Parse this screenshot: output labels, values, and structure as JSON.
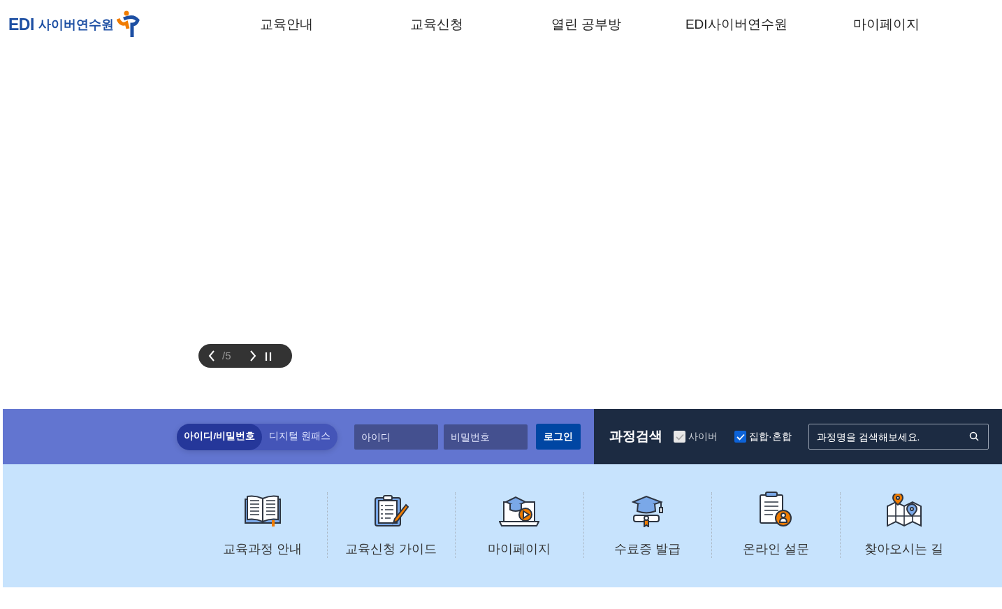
{
  "logo": {
    "brand": "EDI",
    "name": "사이버연수원"
  },
  "nav": [
    "교육안내",
    "교육신청",
    "열린 공부방",
    "EDI사이버연수원",
    "마이페이지"
  ],
  "slider": {
    "counter": "/5",
    "paused": false
  },
  "login": {
    "tabs": [
      {
        "label": "아이디/비밀번호",
        "selected": true
      },
      {
        "label": "디지털 원패스",
        "selected": false
      }
    ],
    "id_field": {
      "placeholder": "아이디"
    },
    "pw_field": {
      "placeholder": "비밀번호"
    },
    "button": "로그인"
  },
  "course_search": {
    "title": "과정검색",
    "filters": [
      {
        "label": "사이버",
        "checked": true,
        "disabled": true
      },
      {
        "label": "집합·혼합",
        "checked": true,
        "disabled": false
      }
    ],
    "field": {
      "placeholder": "과정명을 검색해보세요."
    }
  },
  "quick_links": [
    {
      "kind": "book",
      "label": "교육과정 안내"
    },
    {
      "kind": "clipboard",
      "label": "교육신청 가이드"
    },
    {
      "kind": "laptop",
      "label": "마이페이지"
    },
    {
      "kind": "diploma",
      "label": "수료증 발급"
    },
    {
      "kind": "survey",
      "label": "온라인 설문"
    },
    {
      "kind": "map",
      "label": "찾아오시는 길"
    }
  ]
}
